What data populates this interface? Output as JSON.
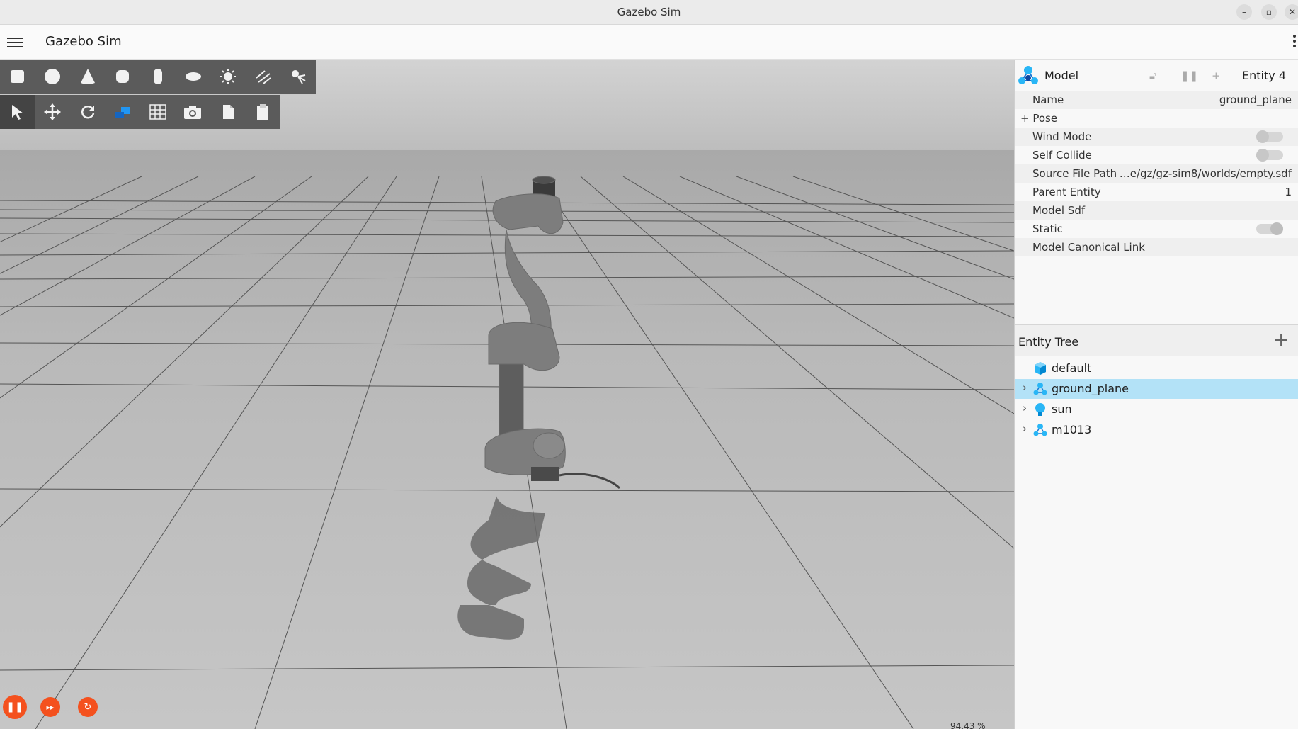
{
  "window": {
    "title": "Gazebo Sim"
  },
  "app": {
    "title": "Gazebo Sim"
  },
  "toolbar": {
    "shapes": [
      "box-icon",
      "sphere-icon",
      "cone-icon",
      "cylinder-icon",
      "capsule-icon",
      "ellipsoid-icon",
      "sun-light-icon",
      "directional-light-icon",
      "spot-light-icon"
    ],
    "tools": [
      "select-icon",
      "translate-icon",
      "rotate-icon",
      "transform-icon",
      "grid-snap-icon",
      "camera-icon",
      "copy-icon",
      "paste-icon"
    ]
  },
  "viewport": {
    "rtf": "94.43 %"
  },
  "component_inspector": {
    "type": "Model",
    "entity": "Entity 4",
    "rows": [
      {
        "key": "Name",
        "value": "ground_plane"
      },
      {
        "key": "+ Pose",
        "value": ""
      },
      {
        "key": "Wind Mode",
        "value": ""
      },
      {
        "key": "Self Collide",
        "value": ""
      },
      {
        "key": "Source File Path",
        "value": "…e/gz/gz-sim8/worlds/empty.sdf"
      },
      {
        "key": "Parent Entity",
        "value": "1"
      },
      {
        "key": "Model Sdf",
        "value": ""
      },
      {
        "key": "Static",
        "value": ""
      },
      {
        "key": "Model Canonical Link",
        "value": ""
      }
    ]
  },
  "entity_tree": {
    "title": "Entity Tree",
    "items": [
      {
        "name": "default",
        "icon": "world-cube-icon"
      },
      {
        "name": "ground_plane",
        "icon": "model-icon"
      },
      {
        "name": "sun",
        "icon": "light-bulb-icon"
      },
      {
        "name": "m1013",
        "icon": "model-icon"
      }
    ]
  },
  "colors": {
    "accent": "#f4511e",
    "selection": "#b3e2f7",
    "toolbar": "#5b5b5b",
    "tree_icon": "#29b6f6"
  }
}
